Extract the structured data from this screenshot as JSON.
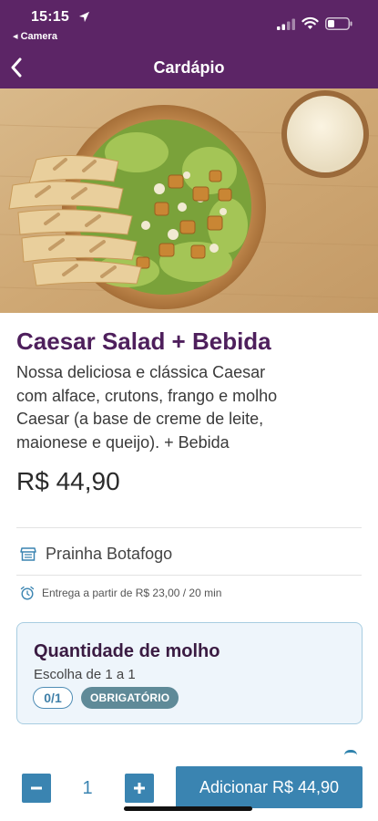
{
  "status_bar": {
    "time": "15:15",
    "back_app": "◂ Camera"
  },
  "navbar": {
    "title": "Cardápio"
  },
  "product": {
    "name": "Caesar Salad + Bebida",
    "description": "Nossa deliciosa e clássica Caesar com alface, crutons, frango e molho Caesar (a base de creme de leite, maionese e queijo). + Bebida",
    "price": "R$ 44,90"
  },
  "store": {
    "name": "Prainha Botafogo",
    "delivery_info": "Entrega a partir de R$ 23,00 / 20 min"
  },
  "option_group": {
    "title": "Quantidade de molho",
    "subtitle": "Escolha de 1 a 1",
    "selected_count": "0/1",
    "required_label": "OBRIGATÓRIO"
  },
  "footer": {
    "quantity": "1",
    "minus_label": "−",
    "plus_label": "+",
    "add_label": "Adicionar R$ 44,90"
  },
  "colors": {
    "header_bg": "#5c2566",
    "accent_blue": "#3a84b1",
    "product_title": "#4e1f5c",
    "badge_bg": "#5f8a98"
  },
  "icons": {
    "back": "chevron-left-icon",
    "store": "storefront-icon",
    "delivery": "alarm-clock-icon"
  }
}
